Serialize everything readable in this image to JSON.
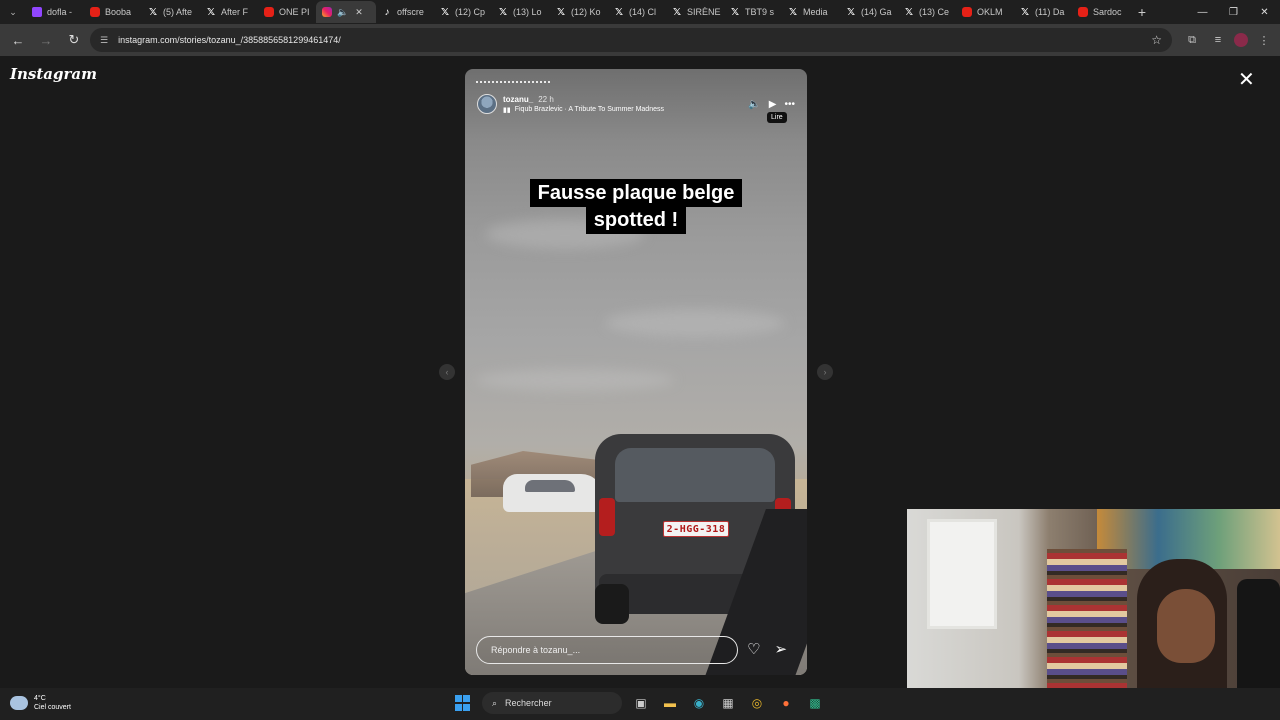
{
  "browser": {
    "tabs": [
      {
        "label": "dofla -",
        "icon": "twitch"
      },
      {
        "label": "Booba",
        "icon": "youtube"
      },
      {
        "label": "(5) Afte",
        "icon": "x"
      },
      {
        "label": "After F",
        "icon": "x"
      },
      {
        "label": "ONE PI",
        "icon": "youtube"
      },
      {
        "label": "",
        "icon": "instagram",
        "active": true
      },
      {
        "label": "offscre",
        "icon": "tiktok"
      },
      {
        "label": "(12) Cp",
        "icon": "x"
      },
      {
        "label": "(13) Lo",
        "icon": "x"
      },
      {
        "label": "(12) Ko",
        "icon": "x"
      },
      {
        "label": "(14) Cl",
        "icon": "x"
      },
      {
        "label": "SIRÈNE",
        "icon": "x"
      },
      {
        "label": "TBT9 s",
        "icon": "x"
      },
      {
        "label": "Media",
        "icon": "x"
      },
      {
        "label": "(14) Ga",
        "icon": "x"
      },
      {
        "label": "(13) Ce",
        "icon": "x"
      },
      {
        "label": "OKLM",
        "icon": "youtube"
      },
      {
        "label": "(11) Da",
        "icon": "x"
      },
      {
        "label": "Sardoc",
        "icon": "youtube"
      }
    ],
    "url": "instagram.com/stories/tozanu_/3858856581299461474/"
  },
  "instagram": {
    "logo": "Instagram",
    "story": {
      "username": "tozanu_",
      "time": "22 h",
      "music": "Fiqub Brazlevic · A Tribute To Summer Madness",
      "tooltip": "Lire",
      "caption_line1": "Fausse plaque belge",
      "caption_line2": "spotted !",
      "plate": "2-HGG-318",
      "reply_placeholder": "Répondre à tozanu_..."
    }
  },
  "taskbar": {
    "temperature": "4°C",
    "weather": "Ciel couvert",
    "search_label": "Rechercher"
  }
}
